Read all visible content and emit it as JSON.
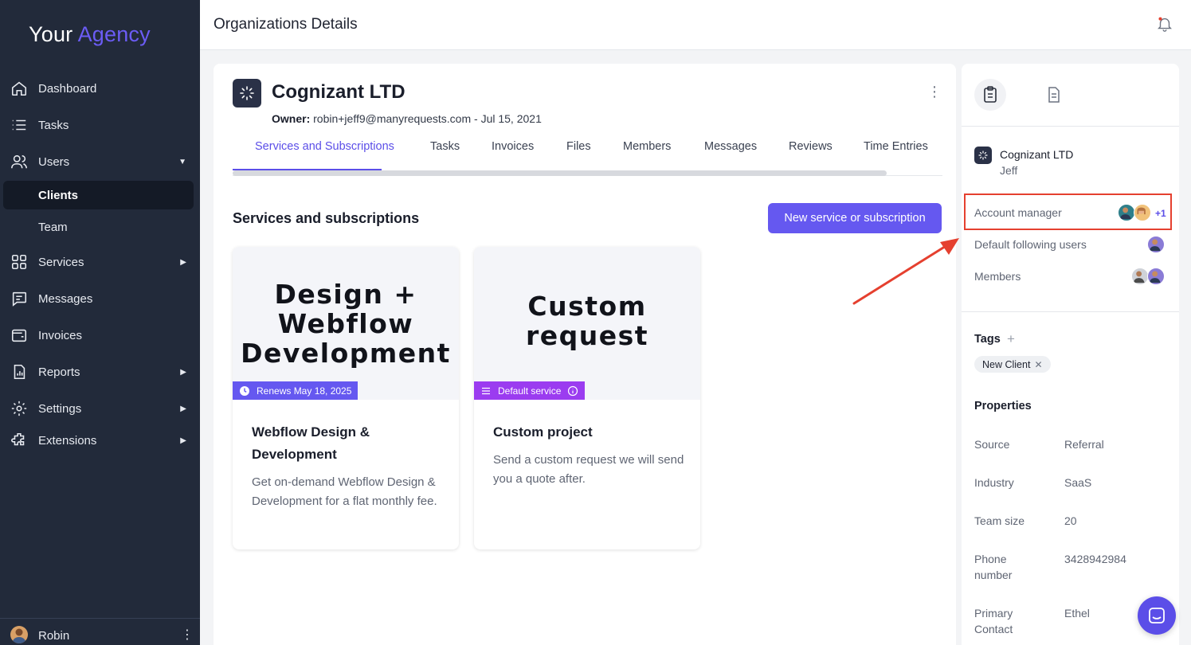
{
  "brand": {
    "part1": "Your",
    "part2": "Agency"
  },
  "sidebar": {
    "items": [
      {
        "label": "Dashboard",
        "icon": "home-icon"
      },
      {
        "label": "Tasks",
        "icon": "list-icon"
      },
      {
        "label": "Users",
        "icon": "users-icon",
        "arrow": "▼"
      },
      {
        "label": "Clients",
        "sub": true,
        "active": true
      },
      {
        "label": "Team",
        "sub": true
      },
      {
        "label": "Services",
        "icon": "grid-icon",
        "arrow": "▶"
      },
      {
        "label": "Messages",
        "icon": "chat-icon"
      },
      {
        "label": "Invoices",
        "icon": "wallet-icon"
      },
      {
        "label": "Reports",
        "icon": "report-icon",
        "arrow": "▶"
      },
      {
        "label": "Settings",
        "icon": "gear-icon",
        "arrow": "▶"
      },
      {
        "label": "Extensions",
        "icon": "puzzle-icon",
        "arrow": "▶"
      }
    ],
    "user": {
      "name": "Robin",
      "menu": "⋮"
    }
  },
  "topbar": {
    "title": "Organizations Details"
  },
  "org": {
    "name": "Cognizant LTD",
    "owner_label": "Owner:",
    "owner_email": "robin+jeff9@manyrequests.com",
    "owner_date": " - Jul 15, 2021",
    "menu": "⋮"
  },
  "tabs": [
    {
      "label": "Services and Subscriptions",
      "active": true
    },
    {
      "label": "Tasks"
    },
    {
      "label": "Invoices"
    },
    {
      "label": "Files"
    },
    {
      "label": "Members"
    },
    {
      "label": "Messages"
    },
    {
      "label": "Reviews"
    },
    {
      "label": "Time Entries"
    }
  ],
  "services": {
    "section_title": "Services and subscriptions",
    "new_button": "New service or subscription",
    "cards": [
      {
        "cover_lines": [
          "Design +",
          "Webflow",
          "Development"
        ],
        "badge": "Renews May 18, 2025",
        "badge_color": "#6558f0",
        "title": "Webflow Design & Development",
        "description": "Get on-demand Webflow Design & Development for a flat monthly fee."
      },
      {
        "cover_lines": [
          "Custom",
          "request"
        ],
        "badge": "Default service",
        "badge_color": "#9b3cf0",
        "title": "Custom project",
        "description": "Send a custom request we will send you a quote after."
      }
    ]
  },
  "panel": {
    "org_name": "Cognizant LTD",
    "person": "Jeff",
    "account_manager_label": "Account manager",
    "account_manager_extra": "+1",
    "following_label": "Default following users",
    "members_label": "Members",
    "tags_title": "Tags",
    "tags_add": "+",
    "tags": [
      "New Client"
    ],
    "tag_remove": "✕",
    "properties_title": "Properties",
    "properties": [
      {
        "key": "Source",
        "value": "Referral"
      },
      {
        "key": "Industry",
        "value": "SaaS"
      },
      {
        "key": "Team size",
        "value": "20"
      },
      {
        "key": "Phone number",
        "value": "3428942984"
      },
      {
        "key": "Primary Contact",
        "value": "Ethel"
      }
    ]
  },
  "colors": {
    "accent": "#6558f0",
    "sidebar_bg": "#222a3a",
    "highlight": "#e5402f",
    "default_badge": "#9b3cf0"
  }
}
